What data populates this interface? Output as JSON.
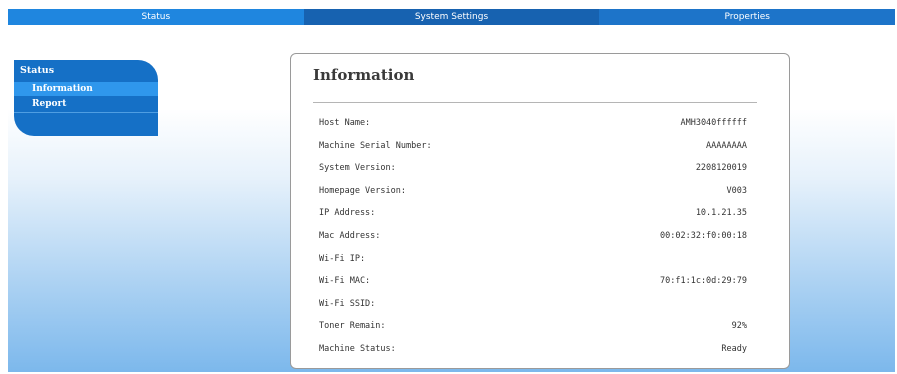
{
  "nav": {
    "tabs": [
      "Status",
      "System Settings",
      "Properties"
    ]
  },
  "sidebar": {
    "heading": "Status",
    "items": [
      "Information",
      "Report"
    ]
  },
  "panel": {
    "title": "Information",
    "rows": [
      {
        "label": "Host Name:",
        "value": "AMH3040ffffff"
      },
      {
        "label": "Machine Serial Number:",
        "value": "AAAAAAAA"
      },
      {
        "label": "System Version:",
        "value": "2208120019"
      },
      {
        "label": "Homepage Version:",
        "value": "V003"
      },
      {
        "label": "IP Address:",
        "value": "10.1.21.35"
      },
      {
        "label": "Mac Address:",
        "value": "00:02:32:f0:00:18"
      },
      {
        "label": "Wi-Fi IP:",
        "value": ""
      },
      {
        "label": "Wi-Fi MAC:",
        "value": "70:f1:1c:0d:29:79"
      },
      {
        "label": "Wi-Fi SSID:",
        "value": ""
      },
      {
        "label": "Toner Remain:",
        "value": "92%"
      },
      {
        "label": "Machine Status:",
        "value": "Ready"
      }
    ]
  },
  "colors": {
    "nav_blue": "#1d74c9",
    "sidebar_blue": "#1570c6",
    "sidebar_active": "#2f97ec"
  }
}
